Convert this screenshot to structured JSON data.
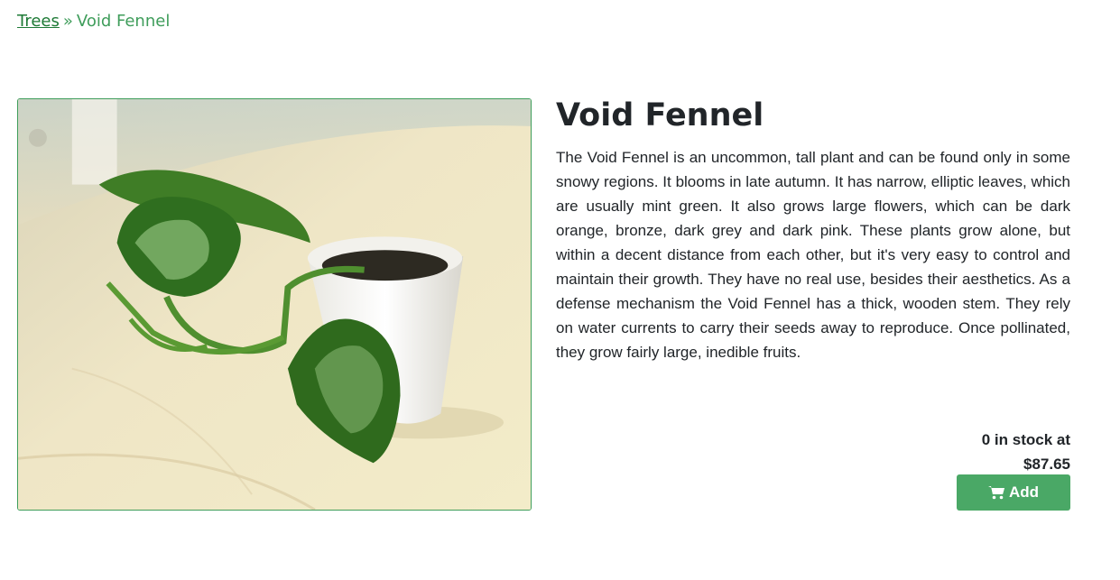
{
  "breadcrumb": {
    "parent_label": "Trees",
    "separator": "»",
    "current_label": "Void Fennel"
  },
  "product": {
    "name": "Void Fennel",
    "description": "The Void Fennel is an uncommon, tall plant and can be found only in some snowy regions. It blooms in late autumn. It has narrow, elliptic leaves, which are usually mint green. It also grows large flowers, which can be dark orange, bronze, dark grey and dark pink. These plants grow alone, but within a decent distance from each other, but it's very easy to control and maintain their growth. They have no real use, besides their aesthetics. As a defense mechanism the Void Fennel has a thick, wooden stem. They rely on water currents to carry their seeds away to reproduce. Once pollinated, they grow fairly large, inedible fruits.",
    "stock_line": "0 in stock at",
    "price": "$87.65",
    "image_icon": "potted-plant-photo"
  },
  "cart": {
    "add_label": "Add",
    "icon": "shopping-cart-icon"
  },
  "colors": {
    "accent": "#3f9d5b",
    "button": "#4aa866",
    "link": "#1e7a36"
  }
}
